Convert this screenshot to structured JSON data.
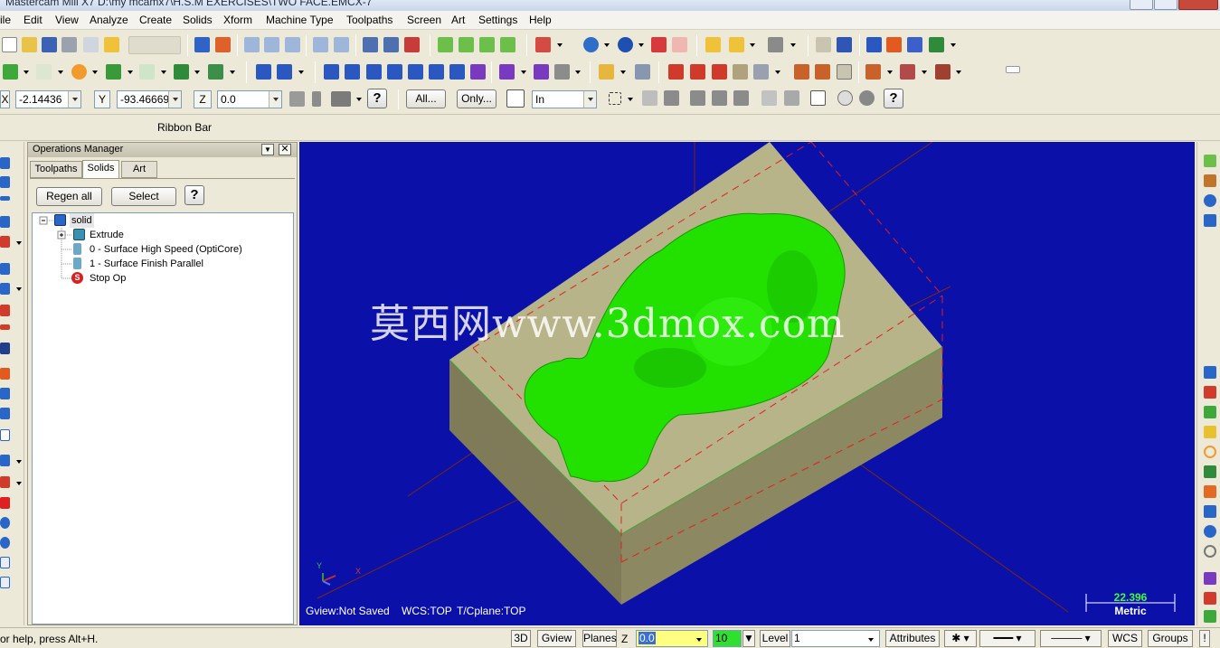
{
  "window": {
    "title": "Mastercam Mill X7  D:\\my mcamx7\\H.S.M EXERCISES\\TWO FACE.EMCX-7"
  },
  "menu": [
    "ile",
    "Edit",
    "View",
    "Analyze",
    "Create",
    "Solids",
    "Xform",
    "Machine Type",
    "Toolpaths",
    "Screen",
    "Art",
    "Settings",
    "Help"
  ],
  "coords": {
    "x_label": "X",
    "x_value": "-2.14436",
    "y_label": "Y",
    "y_value": "-93.46669",
    "z_label": "Z",
    "z_value": "0.0",
    "all_button": "All...",
    "only_button": "Only...",
    "units_select": "In"
  },
  "ribbon": {
    "label": "Ribbon Bar"
  },
  "ops_manager": {
    "title": "Operations Manager",
    "tabs": [
      "Toolpaths",
      "Solids",
      "Art"
    ],
    "active_tab": "Solids",
    "regen_button": "Regen all",
    "select_button": "Select",
    "tree": [
      {
        "label": "solid",
        "level": 0,
        "icon": "solid-icon"
      },
      {
        "label": "Extrude",
        "level": 1,
        "icon": "extrude-icon"
      },
      {
        "label": "0 - Surface High Speed (OptiCore)",
        "level": 1,
        "icon": "toolpath-icon"
      },
      {
        "label": "1 - Surface Finish Parallel",
        "level": 1,
        "icon": "toolpath-icon"
      },
      {
        "label": "Stop Op",
        "level": 1,
        "icon": "stop-icon"
      }
    ]
  },
  "viewport": {
    "watermark": "莫西网www.3dmox.com",
    "gview": "Gview:Not Saved",
    "wcs": "WCS:TOP",
    "tcplane": "T/Cplane:TOP",
    "scale_value": "22.396",
    "scale_unit": "Metric",
    "axis_y": "Y",
    "axis_x": "X",
    "colors": {
      "background": "#0b10a8",
      "stock_top": "#b8b48a",
      "stock_side": "#7f7b58",
      "model": "#22e000"
    }
  },
  "statusbar": {
    "help_text": "or help, press Alt+H.",
    "btn_3d": "3D",
    "btn_gview": "Gview",
    "btn_planes": "Planes",
    "z_label": "Z",
    "z_value": "0.0",
    "color_value": "10",
    "level_label": "Level",
    "level_value": "1",
    "attributes": "Attributes",
    "wcs": "WCS",
    "groups": "Groups",
    "excl": "!"
  }
}
